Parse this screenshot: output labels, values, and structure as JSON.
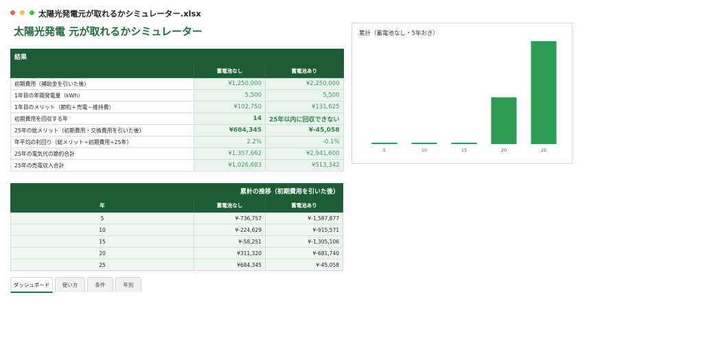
{
  "window": {
    "title": "太陽光発電元が取れるかシミュレーター.xlsx",
    "dot_colors": [
      "#ee5f57",
      "#f5bd4f",
      "#3fc24e"
    ]
  },
  "page": {
    "title": "太陽光発電 元が取れるかシミュレーター"
  },
  "results": {
    "section_title": "結果",
    "headers": [
      "",
      "蓄電池なし",
      "蓄電池あり"
    ],
    "rows": [
      {
        "label": "初期費用（補助金を引いた後）",
        "no_battery": "¥1,250,000",
        "with_battery": "¥2,250,000"
      },
      {
        "label": "1年目の年間発電量（kWh）",
        "no_battery": "5,500",
        "with_battery": "5,500"
      },
      {
        "label": "1年目のメリット（節約＋売電－維持費）",
        "no_battery": "¥102,750",
        "with_battery": "¥131,625"
      },
      {
        "label": "初期費用を回収する年",
        "no_battery": "14",
        "with_battery": "25年以内に回収できない"
      },
      {
        "label": "25年の総メリット（初期費用・交換費用を引いた後）",
        "no_battery": "¥684,345",
        "with_battery": "¥-45,058"
      },
      {
        "label": "年平均の利回り（総メリット÷初期費用÷25年）",
        "no_battery": "2.2%",
        "with_battery": "-0.1%"
      },
      {
        "label": "25年の電気代の節約合計",
        "no_battery": "¥1,357,662",
        "with_battery": "¥2,941,600"
      },
      {
        "label": "25年の売電収入合計",
        "no_battery": "¥1,026,683",
        "with_battery": "¥513,342"
      }
    ]
  },
  "trend": {
    "section_title": "累計の推移（初期費用を引いた後）",
    "headers": [
      "年",
      "蓄電池なし",
      "蓄電池あり"
    ],
    "rows": [
      {
        "year": "5",
        "no_battery": "¥-736,757",
        "with_battery": "¥-1,587,877"
      },
      {
        "year": "10",
        "no_battery": "¥-224,629",
        "with_battery": "¥-915,571"
      },
      {
        "year": "15",
        "no_battery": "¥-58,251",
        "with_battery": "¥-1,305,106"
      },
      {
        "year": "20",
        "no_battery": "¥311,320",
        "with_battery": "¥-681,740"
      },
      {
        "year": "25",
        "no_battery": "¥684,345",
        "with_battery": "¥-45,058"
      }
    ]
  },
  "chart_data": {
    "type": "bar",
    "title": "累計（蓄電池なし・5年おき）",
    "categories": [
      "5",
      "10",
      "15",
      "20",
      "25"
    ],
    "values": [
      1,
      1,
      1,
      311320,
      684345
    ],
    "ylim": [
      0,
      684345
    ],
    "grid": false,
    "bar_color": "#2e9e57"
  },
  "sheet_tabs": [
    {
      "label": "ダッシュボード",
      "active": true
    },
    {
      "label": "使い方",
      "active": false
    },
    {
      "label": "条件",
      "active": false
    },
    {
      "label": "年別",
      "active": false
    }
  ]
}
